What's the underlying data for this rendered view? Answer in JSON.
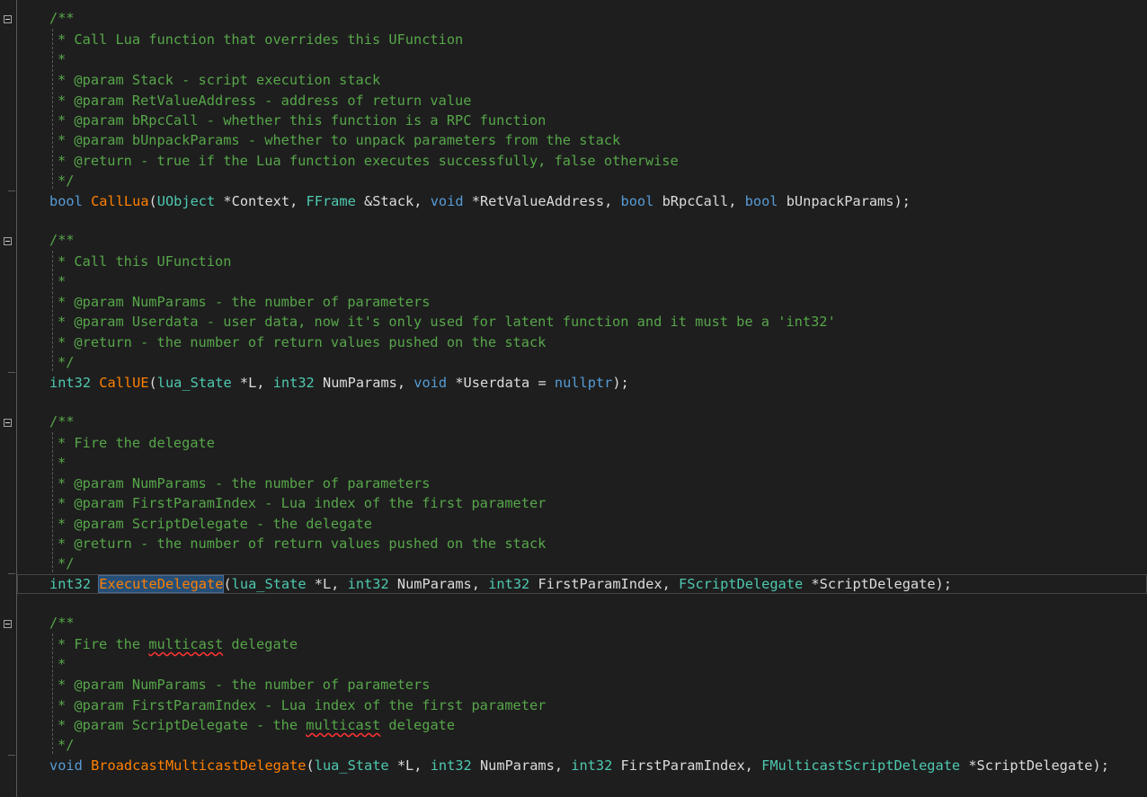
{
  "code_lines": {
    "l1": [
      "/**"
    ],
    "l2": [
      "* Call Lua function that overrides this UFunction"
    ],
    "l3": [
      "*"
    ],
    "l4": [
      "* @param Stack - script execution stack"
    ],
    "l5": [
      "* @param RetValueAddress - address of return value"
    ],
    "l6": [
      "* @param bRpcCall - whether this function is a RPC function"
    ],
    "l7": [
      "* @param bUnpackParams - whether to unpack parameters from the stack"
    ],
    "l8": [
      "* @return - true if the Lua function executes successfully, false otherwise"
    ],
    "l9": [
      "*/"
    ],
    "l10": [
      "bool",
      " ",
      "CallLua",
      "(",
      "UObject",
      " *Context, ",
      "FFrame",
      " &Stack, ",
      "void",
      " *RetValueAddress, ",
      "bool",
      " bRpcCall, ",
      "bool",
      " bUnpackParams);"
    ],
    "l11": [
      "/**"
    ],
    "l12": [
      "* Call this UFunction"
    ],
    "l13": [
      "*"
    ],
    "l14": [
      "* @param NumParams - the number of parameters"
    ],
    "l15": [
      "* @param Userdata - user data, now it's only used for latent function and it must be a 'int32'"
    ],
    "l16": [
      "* @return - the number of return values pushed on the stack"
    ],
    "l17": [
      "*/"
    ],
    "l18": [
      "int32",
      " ",
      "CallUE",
      "(",
      "lua_State",
      " *L, ",
      "int32",
      " NumParams, ",
      "void",
      " *Userdata = ",
      "nullptr",
      ");"
    ],
    "l19": [
      "/**"
    ],
    "l20": [
      "* Fire the delegate"
    ],
    "l21": [
      "*"
    ],
    "l22": [
      "* @param NumParams - the number of parameters"
    ],
    "l23": [
      "* @param FirstParamIndex - Lua index of the first parameter"
    ],
    "l24": [
      "* @param ScriptDelegate - the delegate"
    ],
    "l25": [
      "* @return - the number of return values pushed on the stack"
    ],
    "l26": [
      "*/"
    ],
    "l27": [
      "int32",
      " ",
      "ExecuteDelegate",
      "(",
      "lua_State",
      " *L, ",
      "int32",
      " NumParams, ",
      "int32",
      " FirstParamIndex, ",
      "FScriptDelegate",
      " *ScriptDelegate);"
    ],
    "l28": [
      "/**"
    ],
    "l29": [
      "* Fire the ",
      "multicast",
      " delegate"
    ],
    "l30": [
      "*"
    ],
    "l31": [
      "* @param NumParams - the number of parameters"
    ],
    "l32": [
      "* @param FirstParamIndex - Lua index of the first parameter"
    ],
    "l33": [
      "* @param ScriptDelegate - the ",
      "multicast",
      " delegate"
    ],
    "l34": [
      "*/"
    ],
    "l35": [
      "void",
      " ",
      "BroadcastMulticastDelegate",
      "(",
      "lua_State",
      " *L, ",
      "int32",
      " NumParams, ",
      "int32",
      " FirstParamIndex, ",
      "FMulticastScriptDelegate",
      " *ScriptDelegate);"
    ]
  },
  "theme": {
    "background": "#1e1e1e",
    "comment": "#57a64a",
    "keyword": "#569cd6",
    "function": "#ff8000",
    "type": "#4ec9b0",
    "default_text": "#dcdcdc",
    "selection": "#264f78",
    "spelling_squiggle": "#ff3333"
  },
  "icons": {
    "fold_marker": "collapse-minus-icon"
  }
}
